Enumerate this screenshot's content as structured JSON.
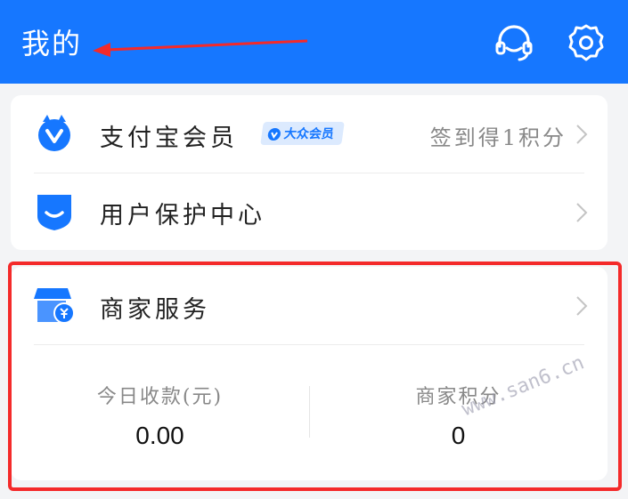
{
  "header": {
    "title": "我的",
    "service_icon": "headset-icon",
    "settings_icon": "gear-icon",
    "bg_color": "#1677ff"
  },
  "rows": [
    {
      "icon": "alipay-member-icon",
      "label": "支付宝会员",
      "badge": "大众会员",
      "right_text": "签到得1积分"
    },
    {
      "icon": "shield-smile-icon",
      "label": "用户保护中心"
    },
    {
      "icon": "merchant-store-icon",
      "label": "商家服务"
    }
  ],
  "merchant_stats": [
    {
      "label": "今日收款(元)",
      "value": "0.00"
    },
    {
      "label": "商家积分",
      "value": "0"
    }
  ],
  "watermark": "www.san6.cn",
  "colors": {
    "accent": "#1677ff",
    "annotation_red": "#f42a2a"
  }
}
